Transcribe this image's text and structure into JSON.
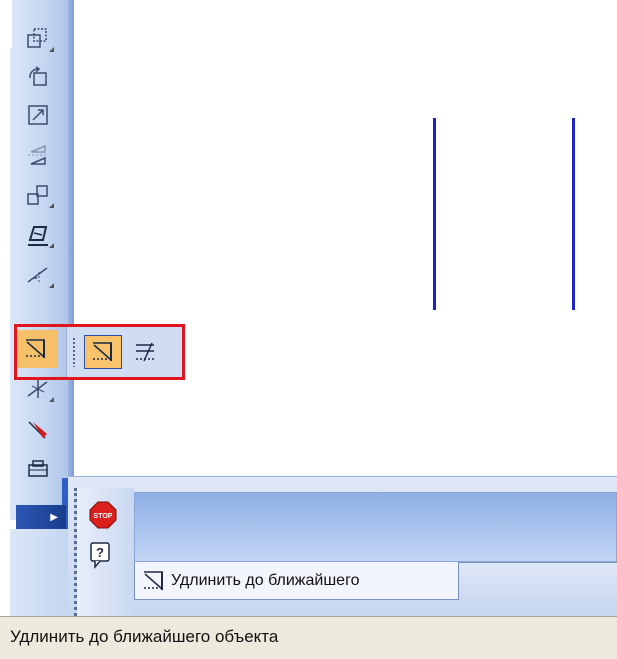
{
  "left_toolbar": {
    "buttons": [
      {
        "icon": "scale-icon"
      },
      {
        "icon": "rotate-icon"
      },
      {
        "icon": "resize-icon"
      },
      {
        "icon": "mirror-icon"
      },
      {
        "icon": "copy-icon"
      },
      {
        "icon": "deform-icon"
      },
      {
        "icon": "trim-icon"
      },
      {
        "icon": "extend-to-nearest-icon"
      },
      {
        "icon": "break-icon"
      },
      {
        "icon": "delete-part-icon"
      },
      {
        "icon": "clip-icon"
      }
    ]
  },
  "flyout": {
    "items": [
      {
        "icon": "extend-to-nearest-icon",
        "active": true
      },
      {
        "icon": "extend-to-objects-icon",
        "active": false
      }
    ]
  },
  "property_panel": {
    "stop_label": "STOP",
    "help_label": "?",
    "tab_label": "Удлинить до ближайшего"
  },
  "status_bar": {
    "text": "Удлинить до ближайшего объекта"
  },
  "colors": {
    "line": "#1a24c8",
    "highlight_border": "#e0161c",
    "active_button": "#f6c068"
  }
}
